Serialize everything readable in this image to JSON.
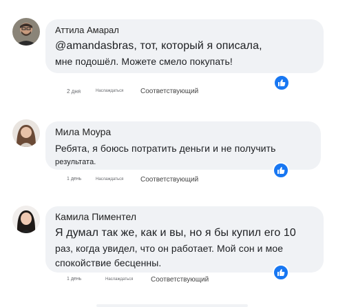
{
  "comments": [
    {
      "author": "Аттила Амарал",
      "text_line1": "@amandasbras, тот, который я описала,",
      "text_line2": "мне подошёл. Можете смело покупать!",
      "time": "2 дня",
      "like_label": "Наслаждаться",
      "reply_label": "Соответствующий",
      "reaction_icon": "thumbs-up-icon"
    },
    {
      "author": "Мила Моура",
      "text_line1": "Ребята, я боюсь потратить деньги и не получить",
      "text_line2": "результата.",
      "time": "1 день",
      "like_label": "Наслаждаться",
      "reply_label": "Соответствующий",
      "reaction_icon": "thumbs-up-icon"
    },
    {
      "author": "Камила Пиментел",
      "text_line1": "Я думал так же, как и вы, но я бы купил его 10",
      "text_line2": "раз, когда увидел, что он работает. Мой сон и мое",
      "text_line3": "спокойствие бесценны.",
      "time": "1 день",
      "like_label": "Наслаждаться",
      "reply_label": "Соответствующий",
      "reaction_icon": "thumbs-up-icon"
    }
  ],
  "colors": {
    "bubble": "#f0f2f5",
    "like_badge": "#1877f2",
    "meta_text": "#65676b"
  }
}
